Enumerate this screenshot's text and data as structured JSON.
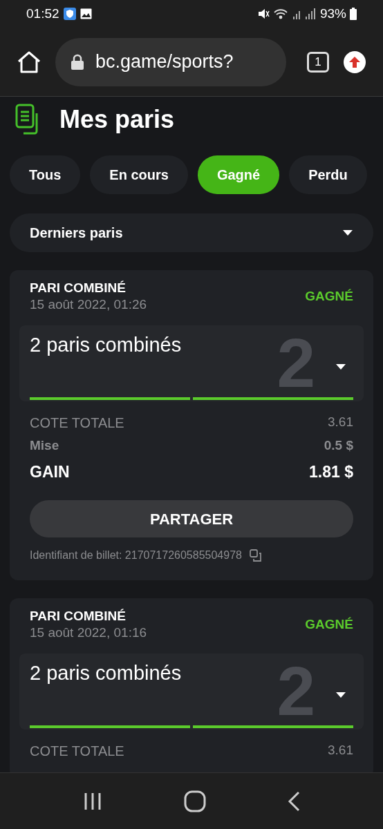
{
  "status_bar": {
    "time": "01:52",
    "battery": "93%"
  },
  "browser": {
    "url": "bc.game/sports?",
    "tab_count": "1"
  },
  "page": {
    "title": "Mes paris"
  },
  "tabs": [
    {
      "label": "Tous",
      "selected": false
    },
    {
      "label": "En cours",
      "selected": false
    },
    {
      "label": "Gagné",
      "selected": true
    },
    {
      "label": "Perdu",
      "selected": false
    }
  ],
  "filter": {
    "value": "Derniers paris"
  },
  "bets": [
    {
      "type": "PARI COMBINÉ",
      "date": "15 août 2022, 01:26",
      "status": "GAGNÉ",
      "summary": "2 paris combinés",
      "count": "2",
      "legs": [
        {
          "won": true
        },
        {
          "won": true
        }
      ],
      "odds_label": "COTE TOTALE",
      "odds": "3.61",
      "stake_label": "Mise",
      "stake": "0.5 $",
      "gain_label": "GAIN",
      "gain": "1.81 $",
      "share": "PARTAGER",
      "ticket": "Identifiant de billet: 2170717260585504978"
    },
    {
      "type": "PARI COMBINÉ",
      "date": "15 août 2022, 01:16",
      "status": "GAGNÉ",
      "summary": "2 paris combinés",
      "count": "2",
      "legs": [
        {
          "won": true
        },
        {
          "won": true
        }
      ],
      "odds_label": "COTE TOTALE",
      "odds": "3.61"
    }
  ]
}
